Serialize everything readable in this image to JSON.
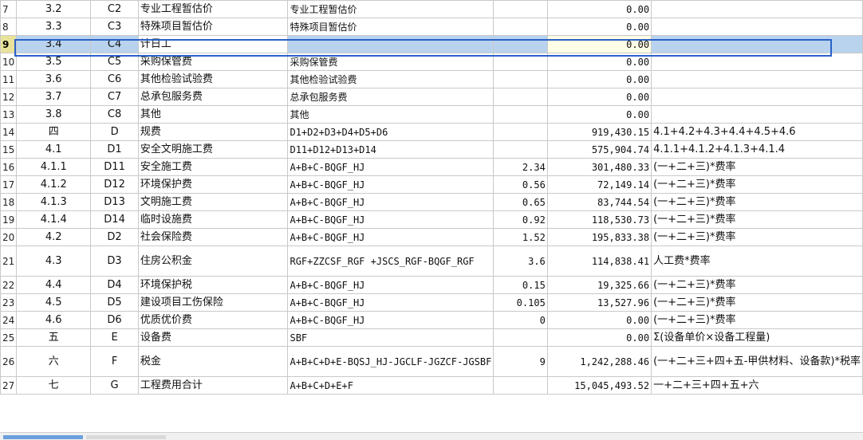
{
  "rows": [
    {
      "num": "7",
      "seq": "3.2",
      "code": "C2",
      "name": "专业工程暂估价",
      "basis": "专业工程暂估价",
      "rate": "",
      "amount": "0.00",
      "note": ""
    },
    {
      "num": "8",
      "seq": "3.3",
      "code": "C3",
      "name": "特殊项目暂估价",
      "basis": "特殊项目暂估价",
      "rate": "",
      "amount": "0.00",
      "note": ""
    },
    {
      "num": "9",
      "seq": "3.4",
      "code": "C4",
      "name": "计日工",
      "basis": "",
      "rate": "",
      "amount": "0.00",
      "note": "",
      "selected": true
    },
    {
      "num": "10",
      "seq": "3.5",
      "code": "C5",
      "name": "采购保管费",
      "basis": "采购保管费",
      "rate": "",
      "amount": "0.00",
      "note": ""
    },
    {
      "num": "11",
      "seq": "3.6",
      "code": "C6",
      "name": "其他检验试验费",
      "basis": "其他检验试验费",
      "rate": "",
      "amount": "0.00",
      "note": ""
    },
    {
      "num": "12",
      "seq": "3.7",
      "code": "C7",
      "name": "总承包服务费",
      "basis": "总承包服务费",
      "rate": "",
      "amount": "0.00",
      "note": ""
    },
    {
      "num": "13",
      "seq": "3.8",
      "code": "C8",
      "name": "其他",
      "basis": "其他",
      "rate": "",
      "amount": "0.00",
      "note": ""
    },
    {
      "num": "14",
      "seq": "四",
      "code": "D",
      "name": "规费",
      "basis": "D1+D2+D3+D4+D5+D6",
      "rate": "",
      "amount": "919,430.15",
      "note": "4.1+4.2+4.3+4.4+4.5+4.6"
    },
    {
      "num": "15",
      "seq": "4.1",
      "code": "D1",
      "name": "安全文明施工费",
      "basis": "D11+D12+D13+D14",
      "rate": "",
      "amount": "575,904.74",
      "note": "4.1.1+4.1.2+4.1.3+4.1.4"
    },
    {
      "num": "16",
      "seq": "4.1.1",
      "code": "D11",
      "name": "安全施工费",
      "basis": "A+B+C-BQGF_HJ",
      "rate": "2.34",
      "amount": "301,480.33",
      "note": "(一+二+三)*费率"
    },
    {
      "num": "17",
      "seq": "4.1.2",
      "code": "D12",
      "name": "环境保护费",
      "basis": "A+B+C-BQGF_HJ",
      "rate": "0.56",
      "amount": "72,149.14",
      "note": "(一+二+三)*费率"
    },
    {
      "num": "18",
      "seq": "4.1.3",
      "code": "D13",
      "name": "文明施工费",
      "basis": "A+B+C-BQGF_HJ",
      "rate": "0.65",
      "amount": "83,744.54",
      "note": "(一+二+三)*费率"
    },
    {
      "num": "19",
      "seq": "4.1.4",
      "code": "D14",
      "name": "临时设施费",
      "basis": "A+B+C-BQGF_HJ",
      "rate": "0.92",
      "amount": "118,530.73",
      "note": "(一+二+三)*费率"
    },
    {
      "num": "20",
      "seq": "4.2",
      "code": "D2",
      "name": "社会保险费",
      "basis": "A+B+C-BQGF_HJ",
      "rate": "1.52",
      "amount": "195,833.38",
      "note": "(一+二+三)*费率"
    },
    {
      "num": "21",
      "seq": "4.3",
      "code": "D3",
      "name": "住房公积金",
      "basis": "RGF+ZZCSF_RGF +JSCS_RGF-BQGF_RGF",
      "rate": "3.6",
      "amount": "114,838.41",
      "note": "人工费*费率",
      "tall": true
    },
    {
      "num": "22",
      "seq": "4.4",
      "code": "D4",
      "name": "环境保护税",
      "basis": "A+B+C-BQGF_HJ",
      "rate": "0.15",
      "amount": "19,325.66",
      "note": "(一+二+三)*费率"
    },
    {
      "num": "23",
      "seq": "4.5",
      "code": "D5",
      "name": "建设项目工伤保险",
      "basis": "A+B+C-BQGF_HJ",
      "rate": "0.105",
      "amount": "13,527.96",
      "note": "(一+二+三)*费率"
    },
    {
      "num": "24",
      "seq": "4.6",
      "code": "D6",
      "name": "优质优价费",
      "basis": "A+B+C-BQGF_HJ",
      "rate": "0",
      "amount": "0.00",
      "note": "(一+二+三)*费率"
    },
    {
      "num": "25",
      "seq": "五",
      "code": "E",
      "name": "设备费",
      "basis": "SBF",
      "rate": "",
      "amount": "0.00",
      "note": "Σ(设备单价×设备工程量)"
    },
    {
      "num": "26",
      "seq": "六",
      "code": "F",
      "name": "税金",
      "basis": "A+B+C+D+E-BQSJ_HJ-JGCLF-JGZCF-JGSBF",
      "rate": "9",
      "amount": "1,242,288.46",
      "note": "(一+二+三+四+五-甲供材料、设备款)*税率",
      "tall": true
    },
    {
      "num": "27",
      "seq": "七",
      "code": "G",
      "name": "工程费用合计",
      "basis": "A+B+C+D+E+F",
      "rate": "",
      "amount": "15,045,493.52",
      "note": "一+二+三+四+五+六"
    }
  ]
}
